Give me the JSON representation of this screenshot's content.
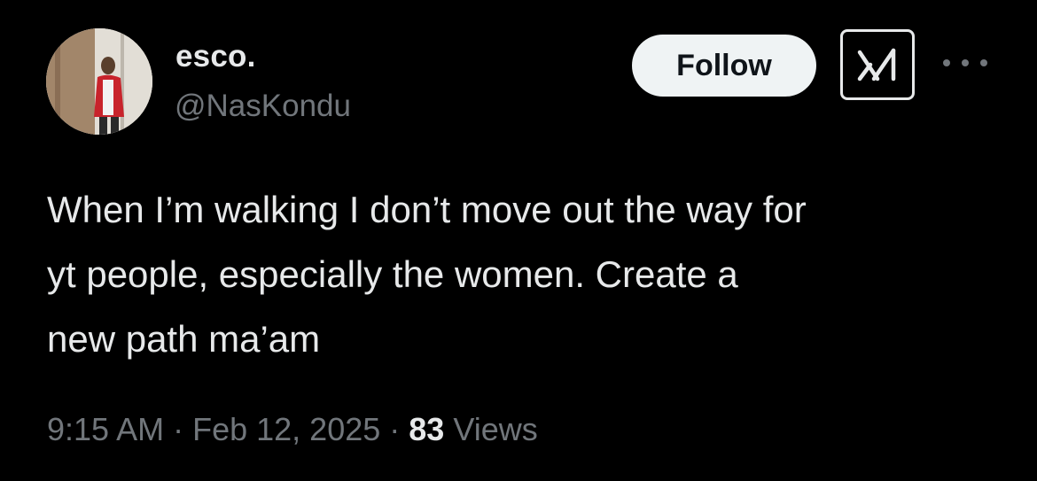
{
  "author": {
    "display_name": "esco.",
    "handle": "@NasKondu",
    "avatar_icon": "profile-photo"
  },
  "actions": {
    "follow_label": "Follow",
    "grok_icon": "grok-icon",
    "more_icon": "more-horizontal-icon"
  },
  "tweet": {
    "text": "When I’m walking I don’t move out the way for\nyt people, especially the women. Create a\nnew path ma’am",
    "time": "9:15 AM",
    "date": "Feb 12, 2025",
    "separator": " · ",
    "views_count": "83",
    "views_label": "Views"
  },
  "colors": {
    "background": "#000000",
    "primary_text": "#e7e9ea",
    "secondary_text": "#71767b",
    "follow_bg": "#eff3f4",
    "follow_text": "#0f1419"
  }
}
